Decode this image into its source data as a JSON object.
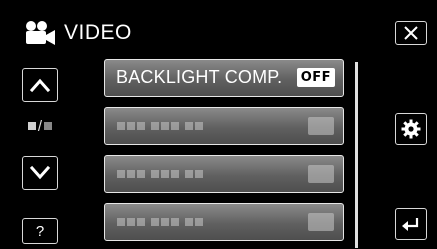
{
  "header": {
    "title": "VIDEO",
    "icon": "video-camera-icon"
  },
  "left_controls": {
    "up_icon": "chevron-up-icon",
    "down_icon": "chevron-down-icon",
    "pager_label": "page-indicator",
    "help_label": "?"
  },
  "right_controls": {
    "close_icon": "close-icon",
    "settings_icon": "gear-icon",
    "back_icon": "return-icon"
  },
  "menu": {
    "items": [
      {
        "label": "BACKLIGHT COMP.",
        "value": "OFF"
      }
    ]
  },
  "colors": {
    "background": "#000000",
    "item_fill": "#6a6a6a",
    "border": "#e6e6e6"
  }
}
